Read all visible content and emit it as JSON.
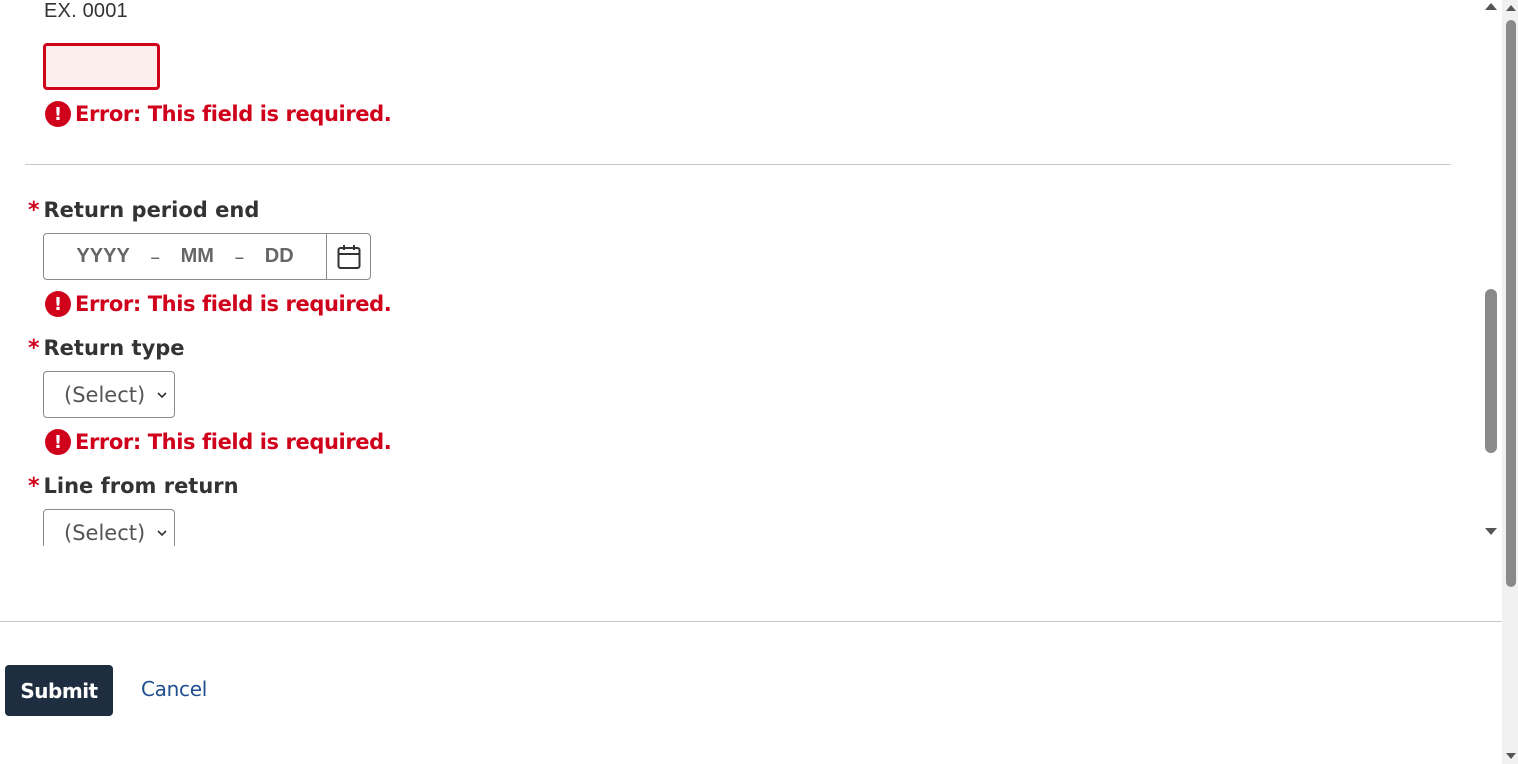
{
  "field_hint": "EX. 0001",
  "error_message": "Error: This field is required.",
  "error_icon": "exclamation-circle-icon",
  "error_color": "#d0021b",
  "required_marker": "*",
  "return_period_end": {
    "label": "Return period end",
    "year_placeholder": "YYYY",
    "month_placeholder": "MM",
    "day_placeholder": "DD",
    "separator": "–",
    "calendar_icon": "calendar-icon"
  },
  "return_type": {
    "label": "Return type",
    "selected": "(Select)"
  },
  "line_from_return": {
    "label": "Line from return",
    "selected": "(Select)"
  },
  "actions": {
    "submit_label": "Submit",
    "cancel_label": "Cancel",
    "submit_color": "#1f2d40",
    "cancel_color": "#1f4f8f"
  }
}
